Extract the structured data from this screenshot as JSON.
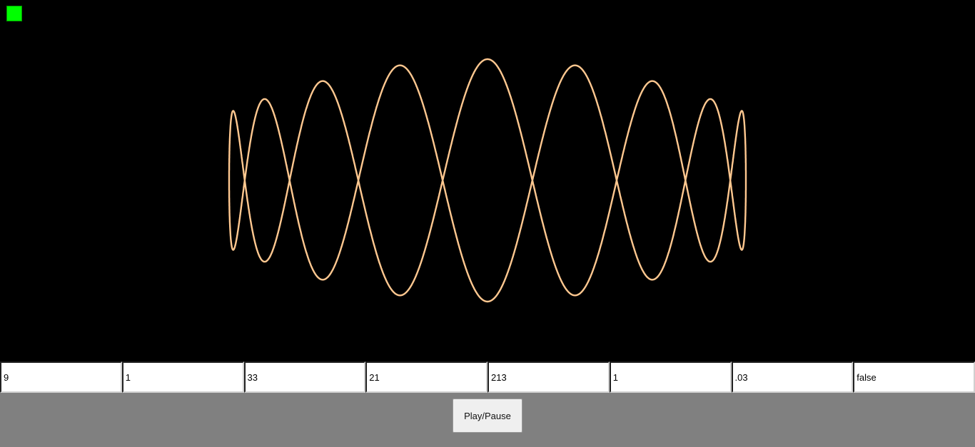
{
  "indicator": {
    "color": "#00ff00"
  },
  "curve": {
    "stroke_color": "#ffc890"
  },
  "params": [
    "9",
    "1",
    "33",
    "21",
    "213",
    "1",
    ".03",
    "false"
  ],
  "controls": {
    "play_pause_label": "Play/Pause"
  }
}
